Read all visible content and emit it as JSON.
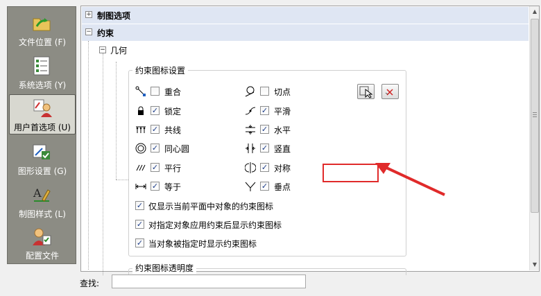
{
  "sidebar": {
    "items": [
      {
        "label": "文件位置 (F)",
        "icon": "folder-arrow-icon"
      },
      {
        "label": "系统选项 (Y)",
        "icon": "checklist-icon"
      },
      {
        "label": "用户首选项 (U)",
        "icon": "user-preferences-icon"
      },
      {
        "label": "图形设置 (G)",
        "icon": "graphics-settings-icon"
      },
      {
        "label": "制图样式 (L)",
        "icon": "drafting-style-icon"
      },
      {
        "label": "配置文件",
        "icon": "profile-icon"
      }
    ],
    "selected_index": 2
  },
  "tree": {
    "drafting_options": "制图选项",
    "constraints": "约束",
    "geometry": "几何"
  },
  "constraint_icons": {
    "group_title": "约束图标设置",
    "left": [
      {
        "label": "重合",
        "checked": false,
        "icon": "coincident-icon"
      },
      {
        "label": "锁定",
        "checked": true,
        "icon": "lock-icon"
      },
      {
        "label": "共线",
        "checked": true,
        "icon": "collinear-icon"
      },
      {
        "label": "同心圆",
        "checked": true,
        "icon": "concentric-icon"
      },
      {
        "label": "平行",
        "checked": true,
        "icon": "parallel-icon"
      },
      {
        "label": "等于",
        "checked": true,
        "icon": "equal-icon"
      }
    ],
    "right": [
      {
        "label": "切点",
        "checked": false,
        "icon": "tangent-icon"
      },
      {
        "label": "平滑",
        "checked": true,
        "icon": "smooth-icon"
      },
      {
        "label": "水平",
        "checked": true,
        "icon": "horizontal-icon"
      },
      {
        "label": "竖直",
        "checked": true,
        "icon": "vertical-icon"
      },
      {
        "label": "对称",
        "checked": true,
        "icon": "symmetric-icon"
      },
      {
        "label": "垂点",
        "checked": true,
        "icon": "perpendicular-icon"
      }
    ],
    "options": [
      {
        "label": "仅显示当前平面中对象的约束图标",
        "checked": true
      },
      {
        "label": "对指定对象应用约束后显示约束图标",
        "checked": true
      },
      {
        "label": "当对象被指定时显示约束图标",
        "checked": true
      }
    ],
    "select_all_icon": "select-all-icon",
    "clear_all_icon": "clear-all-icon"
  },
  "transparency": {
    "group_title": "约束图标透明度"
  },
  "find": {
    "label": "查找:",
    "value": ""
  },
  "colors": {
    "highlight": "#e02a2a",
    "tree_row_bg": "#dfe6f3",
    "sidebar_bg": "#8c8c84"
  }
}
